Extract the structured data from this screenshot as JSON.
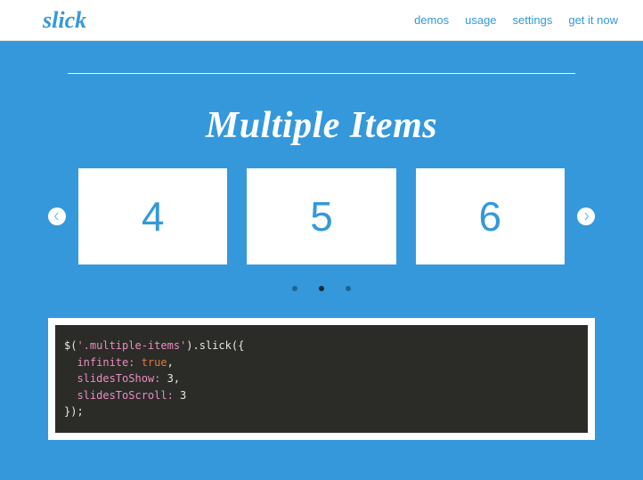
{
  "brand": "slick",
  "nav": {
    "demos": "demos",
    "usage": "usage",
    "settings": "settings",
    "get_it_now": "get it now"
  },
  "section": {
    "title": "Multiple Items"
  },
  "carousel": {
    "slides": [
      "4",
      "5",
      "6"
    ],
    "active_dot_index": 1,
    "dot_count": 3
  },
  "code": {
    "line1_a": "$(",
    "line1_sel": "'.multiple-items'",
    "line1_b": ").slick({",
    "line2_key": "  infinite:",
    "line2_val": " true",
    "line2_comma": ",",
    "line3_key": "  slidesToShow:",
    "line3_val": " 3",
    "line3_comma": ",",
    "line4_key": "  slidesToScroll:",
    "line4_val": " 3",
    "line5": "});"
  }
}
